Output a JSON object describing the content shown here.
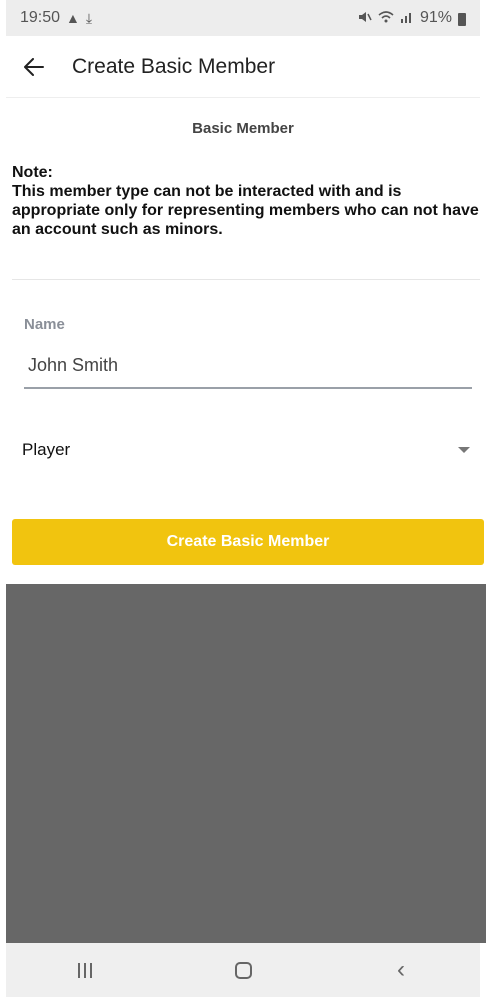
{
  "status_bar": {
    "time": "19:50",
    "left_icons": [
      "alert-icon",
      "download-icon"
    ],
    "right_icons": [
      "mute-icon",
      "wifi-icon",
      "signal-icon"
    ],
    "battery": "91%"
  },
  "app_bar": {
    "title": "Create Basic Member",
    "back_icon": "arrow-left-icon"
  },
  "form": {
    "section_title": "Basic Member",
    "note_heading": "Note:",
    "note_body": "This member type can not be interacted with and is appropriate only for representing members who can not have an account such as minors.",
    "name_label": "Name",
    "name_value": "John Smith",
    "role_select_value": "Player",
    "submit_label": "Create Basic Member"
  },
  "nav_bar": {
    "icons": [
      "recents-icon",
      "home-icon",
      "back-icon"
    ]
  },
  "colors": {
    "accent": "#f1c40f",
    "overlay": "#676767",
    "status_bar": "#ededed",
    "nav_bar": "#efefef"
  }
}
